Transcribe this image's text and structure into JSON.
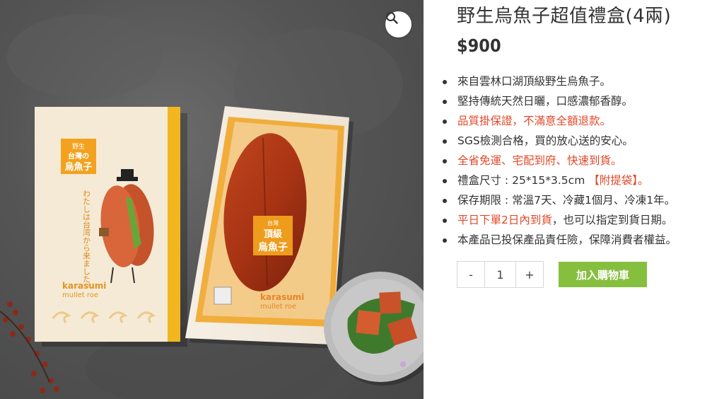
{
  "product": {
    "title": "野生烏魚子超值禮盒(4兩)",
    "price": "$900",
    "features": [
      {
        "text": "來自雲林口湖頂級野生烏魚子。"
      },
      {
        "text": "堅持傳統天然日曬，口感濃郁香醇。"
      },
      {
        "text": "品質掛保證，不滿意全額退款。"
      },
      {
        "text": "SGS檢測合格，買的放心送的安心。"
      },
      {
        "text": "全省免運、宅配到府、快速到貨。"
      },
      {
        "text": "禮盒尺寸 : 25*15*3.5cm ",
        "highlight": "【附提袋】。"
      },
      {
        "text": "保存期限 : 常溫7天、冷藏1個月、冷凍1年。"
      },
      {
        "highlight_first": "平日下單2日內到貨",
        "text": "，也可以指定到貨日期。"
      },
      {
        "text": "本產品已投保產品責任險，保障消費者權益。"
      }
    ]
  },
  "cart": {
    "minus_label": "-",
    "quantity": "1",
    "plus_label": "+",
    "add_label": "加入購物車"
  },
  "image": {
    "zoom_icon": "magnifier-icon",
    "box_tag_1": "野生",
    "box_tag_2": "台灣の",
    "box_tag_3": "烏魚子",
    "box_brand": "karasumi",
    "box_sub": "mullet roe",
    "box_vertical": "わたしは台湾から来ました。",
    "tray_tag_1": "台灣",
    "tray_tag_2": "頂級",
    "tray_tag_3": "烏魚子",
    "tray_brand": "karasumi",
    "tray_sub": "mullet roe"
  },
  "colors": {
    "accent_red": "#e0482a",
    "cart_green": "#86bf3e",
    "box_orange": "#f0a21e"
  }
}
